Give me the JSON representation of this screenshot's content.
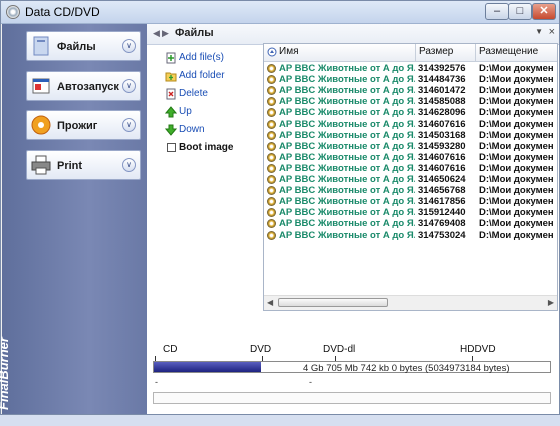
{
  "window": {
    "title": "Data CD/DVD"
  },
  "sidebar": {
    "items": [
      {
        "label": "Файлы"
      },
      {
        "label": "Автозапуск"
      },
      {
        "label": "Прожиг"
      },
      {
        "label": "Print"
      }
    ],
    "brand": "FinalBurner"
  },
  "pathbar": {
    "crumb": "Файлы"
  },
  "actions": {
    "add_files": "Add file(s)",
    "add_folder": "Add folder",
    "delete": "Delete",
    "up": "Up",
    "down": "Down",
    "boot_image": "Boot image"
  },
  "filelist": {
    "columns": [
      "Имя",
      "Размер",
      "Размещение"
    ],
    "rows": [
      {
        "name": "AP  BBC  Животные от А до Я...",
        "size": "314392576",
        "location": "D:\\Мои докумен"
      },
      {
        "name": "AP  BBC  Животные от А до Я...",
        "size": "314484736",
        "location": "D:\\Мои докумен"
      },
      {
        "name": "AP  BBC  Животные от А до Я...",
        "size": "314601472",
        "location": "D:\\Мои докумен"
      },
      {
        "name": "AP  BBC  Животные от А до Я...",
        "size": "314585088",
        "location": "D:\\Мои докумен"
      },
      {
        "name": "AP  BBC  Животные от А до Я...",
        "size": "314628096",
        "location": "D:\\Мои докумен"
      },
      {
        "name": "AP  BBC  Животные от А до Я...",
        "size": "314607616",
        "location": "D:\\Мои докумен"
      },
      {
        "name": "AP  BBC  Животные от А до Я...",
        "size": "314503168",
        "location": "D:\\Мои докумен"
      },
      {
        "name": "AP  BBC  Животные от А до Я...",
        "size": "314593280",
        "location": "D:\\Мои докумен"
      },
      {
        "name": "AP  BBC  Животные от А до Я...",
        "size": "314607616",
        "location": "D:\\Мои докумен"
      },
      {
        "name": "AP  BBC  Животные от А до Я...",
        "size": "314607616",
        "location": "D:\\Мои докумен"
      },
      {
        "name": "AP  BBC  Животные от А до Я...",
        "size": "314650624",
        "location": "D:\\Мои докумен"
      },
      {
        "name": "AP  BBC  Животные от А до Я...",
        "size": "314656768",
        "location": "D:\\Мои докумен"
      },
      {
        "name": "AP  BBC  Животные от А до Я...",
        "size": "314617856",
        "location": "D:\\Мои докумен"
      },
      {
        "name": "AP  BBC  Животные от А до Я...",
        "size": "315912440",
        "location": "D:\\Мои докумен"
      },
      {
        "name": "AP  BBC  Животные от А до Я...",
        "size": "314769408",
        "location": "D:\\Мои докумен"
      },
      {
        "name": "AP  BBC  Животные от А до Я...",
        "size": "314753024",
        "location": "D:\\Мои докумен"
      }
    ]
  },
  "capacity": {
    "labels": [
      "CD",
      "DVD",
      "DVD-dl",
      "HDDVD"
    ],
    "info": "4 Gb  705 Mb  742 kb  0 bytes  (5034973184 bytes)",
    "fill_fraction": 0.27
  },
  "colors": {
    "accent": "#1a4eb5",
    "filename": "#1a8a6a",
    "sidebar": "#6a79a6",
    "capacity_fill": "#1e2380"
  }
}
